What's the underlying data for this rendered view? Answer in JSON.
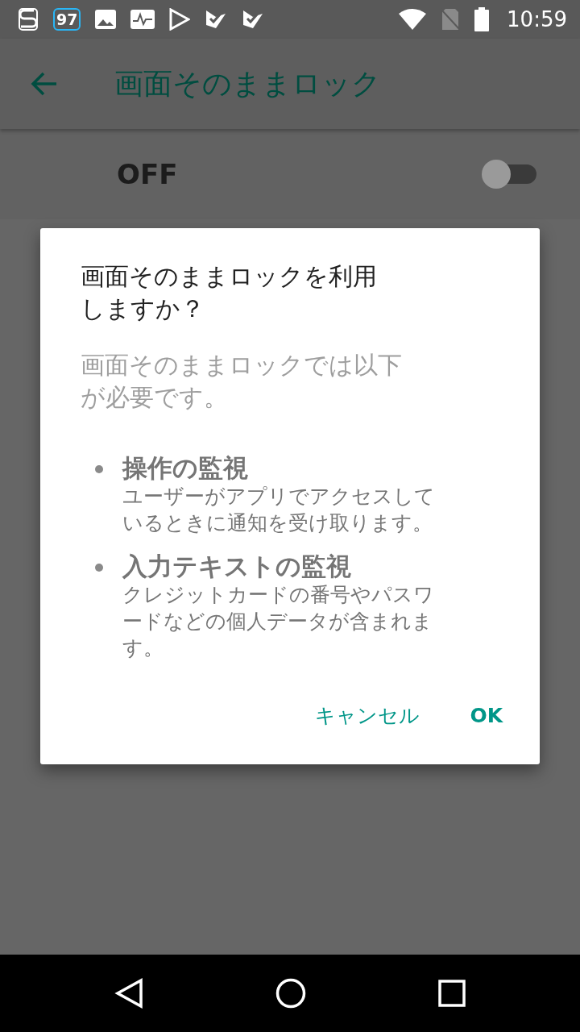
{
  "status_bar": {
    "badge": "97",
    "time": "10:59"
  },
  "toolbar": {
    "title": "画面そのままロック"
  },
  "master_switch": {
    "label": "OFF",
    "on": false
  },
  "dialog": {
    "title": "画面そのままロックを利用しますか？",
    "message": "画面そのままロックでは以下が必要です。",
    "items": [
      {
        "title": "操作の監視",
        "description": "ユーザーがアプリでアクセスしているときに通知を受け取ります。"
      },
      {
        "title": "入力テキストの監視",
        "description": "クレジットカードの番号やパスワードなどの個人データが含まれます。"
      }
    ],
    "buttons": [
      "キャンセル",
      "OK"
    ]
  }
}
